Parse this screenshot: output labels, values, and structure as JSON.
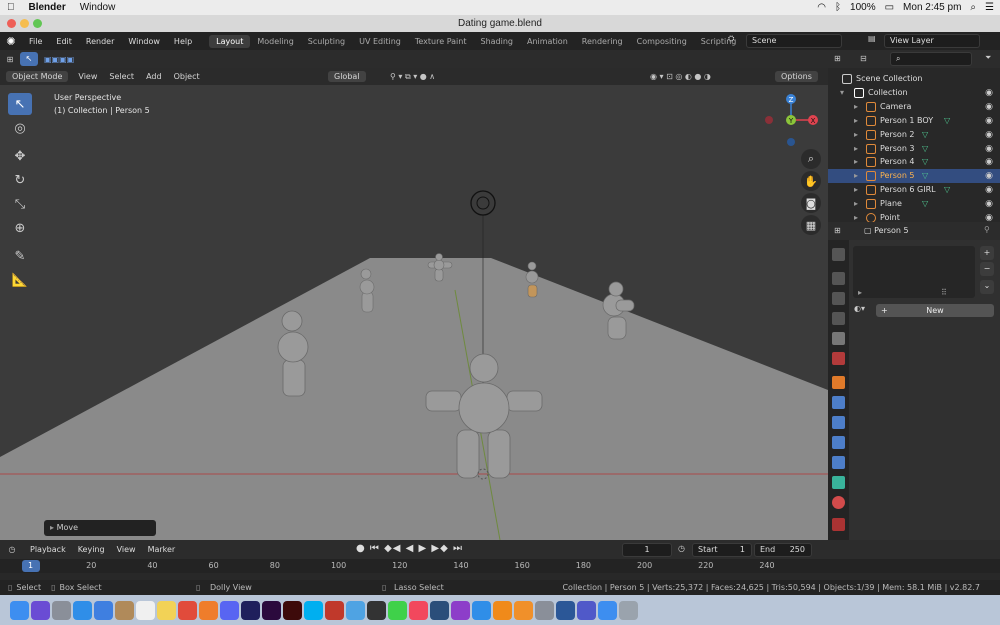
{
  "macbar": {
    "apple": "",
    "app": "Blender",
    "menu": "Window",
    "battery": "100%",
    "clock": "Mon 2:45 pm"
  },
  "window": {
    "title": "Dating game.blend"
  },
  "topbar": {
    "menus": [
      "File",
      "Edit",
      "Render",
      "Window",
      "Help"
    ],
    "workspaces": [
      "Layout",
      "Modeling",
      "Sculpting",
      "UV Editing",
      "Texture Paint",
      "Shading",
      "Animation",
      "Rendering",
      "Compositing",
      "Scripting"
    ],
    "active_workspace": "Layout",
    "scene": "Scene",
    "view_layer": "View Layer",
    "add_tab": "+"
  },
  "viewport_header": {
    "mode": "Object Mode",
    "menus": [
      "View",
      "Select",
      "Add",
      "Object"
    ],
    "orientation": "Global",
    "options": "Options"
  },
  "viewport": {
    "info_line1": "User Perspective",
    "info_line2": "(1) Collection | Person 5",
    "operator": "Move",
    "gizmo_axes": {
      "x": "X",
      "y": "Y",
      "z": "Z"
    },
    "axis_colors": {
      "x": "#e0434f",
      "y": "#8bc43a",
      "z": "#3a82d6"
    }
  },
  "outliner": {
    "rows": [
      {
        "label": "Scene Collection",
        "indent": 0,
        "kind": "scene"
      },
      {
        "label": "Collection",
        "indent": 1,
        "kind": "collection"
      },
      {
        "label": "Camera",
        "indent": 2,
        "kind": "camera"
      },
      {
        "label": "Person 1 BOY",
        "indent": 2,
        "kind": "mesh"
      },
      {
        "label": "Person 2",
        "indent": 2,
        "kind": "mesh"
      },
      {
        "label": "Person 3",
        "indent": 2,
        "kind": "mesh"
      },
      {
        "label": "Person 4",
        "indent": 2,
        "kind": "mesh"
      },
      {
        "label": "Person 5",
        "indent": 2,
        "kind": "mesh",
        "selected": true
      },
      {
        "label": "Person 6 GIRL",
        "indent": 2,
        "kind": "mesh"
      },
      {
        "label": "Plane",
        "indent": 2,
        "kind": "mesh"
      },
      {
        "label": "Point",
        "indent": 2,
        "kind": "light"
      }
    ]
  },
  "properties": {
    "object_name": "Person 5",
    "new_button": "New",
    "plus": "+",
    "minus": "−",
    "more": "⌄"
  },
  "timeline": {
    "menus": [
      "Playback",
      "Keying",
      "View",
      "Marker"
    ],
    "current_frame": "1",
    "start_label": "Start",
    "start": "1",
    "end_label": "End",
    "end": "250",
    "ticks": [
      "1",
      "20",
      "40",
      "60",
      "80",
      "100",
      "120",
      "140",
      "160",
      "180",
      "200",
      "220",
      "240"
    ]
  },
  "status": {
    "select": "Select",
    "box_select": "Box Select",
    "dolly": "Dolly View",
    "lasso": "Lasso Select",
    "stats": "Collection | Person 5 | Verts:25,372 | Faces:24,625 | Tris:50,594 | Objects:1/39 | Mem: 58.1 MiB | v2.82.7"
  },
  "dock": [
    "Finder",
    "Siri",
    "Launchpad",
    "Safari",
    "Mail",
    "Contacts",
    "Calendar",
    "Notes",
    "Chrome",
    "Firefox",
    "Discord",
    "After Effects",
    "Premiere",
    "Animate",
    "Skype",
    "Photo Booth",
    "Preview",
    "Clock",
    "Messages",
    "Music",
    "Blender",
    "Podcasts",
    "App Store",
    "VLC",
    "Books",
    "System Preferences",
    "Word",
    "Teams",
    "Finder 2",
    "Trash"
  ]
}
